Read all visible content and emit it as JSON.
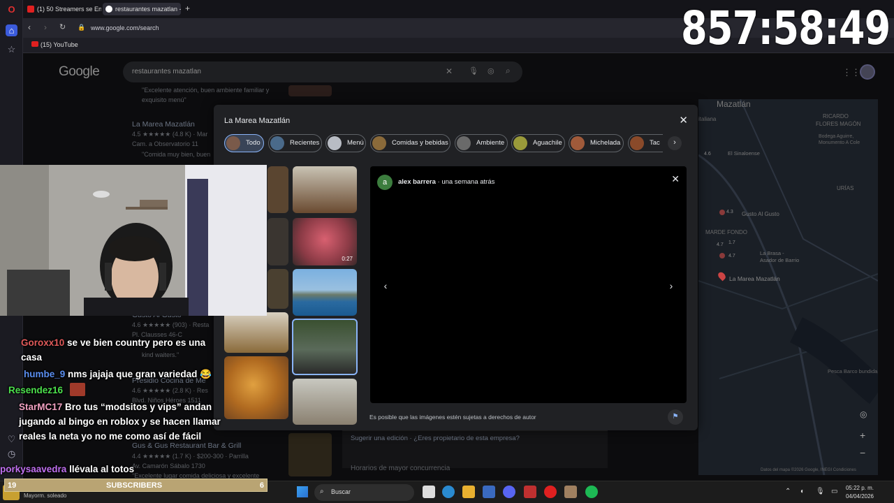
{
  "tabs": [
    {
      "label": "(1) 50 Streamers se Enfren"
    },
    {
      "label": "restaurantes mazatlan - B"
    }
  ],
  "address": {
    "url": "www.google.com/search"
  },
  "bookmarks": [
    {
      "label": "(15) YouTube"
    }
  ],
  "google": {
    "logo": "Google",
    "query": "restaurantes mazatlan"
  },
  "background_results": [
    {
      "text": "\"Excelente atención, buen ambiente familiar y"
    },
    {
      "text": "exquisito menú\""
    },
    {
      "text": "La Marea Mazatlán"
    },
    {
      "text": "4.5 ★★★★★ (4.8 K) · Mar"
    },
    {
      "text": "Cam. a Observatorio 11"
    },
    {
      "text": "\"Comida muy bien, buen"
    },
    {
      "text": "Gusto Al Gusto"
    },
    {
      "text": "4.6 ★★★★★ (903) · Resta"
    },
    {
      "text": "Pl. Clausses 46-C"
    },
    {
      "text": "kind waiters.\""
    },
    {
      "text": "Presidio Cocina de Me"
    },
    {
      "text": "4.6 ★★★★★ (2.8 K) · Res"
    },
    {
      "text": "Blvd. Niños Héroes 1511"
    },
    {
      "text": "Gus & Gus Restaurant Bar & Grill"
    },
    {
      "text": "4.4 ★★★★★ (1.7 K) · $200-300 · Parrilla"
    },
    {
      "text": "Av. Camarón Sábalo 1730"
    },
    {
      "text": "\"Excelente lugar comida deliciosa y excelente"
    }
  ],
  "panel_links": {
    "suggest": "Sugerir una edición · ¿Eres propietario de esta empresa?",
    "busy": "Horarios de mayor concurrencia"
  },
  "map": {
    "title": "Mazatlán",
    "labels": [
      "RICARDO",
      "FLORES MAGÓN",
      "URÍAS",
      "MARDE FONDO",
      "Gusto Al Gusto",
      "La Marea Mazatlán",
      "La Brasa -",
      "Asador de Barrio",
      "El Sinaloense",
      "Pesca Barco bundida",
      "Bodega Aguirre,",
      "Monumento A Cole",
      "italiana"
    ],
    "ratings": [
      "4.6",
      "4.3",
      "4.7",
      "1.7",
      "4.7"
    ],
    "attribution": "Datos del mapa ©2026 Google, INEGI   Condiciones"
  },
  "modal": {
    "title": "La Marea Mazatlán",
    "chips": [
      {
        "label": "Todo",
        "active": true
      },
      {
        "label": "Recientes"
      },
      {
        "label": "Menú"
      },
      {
        "label": "Comidas y bebidas"
      },
      {
        "label": "Ambiente"
      },
      {
        "label": "Aguachile"
      },
      {
        "label": "Michelada"
      },
      {
        "label": "Tac"
      }
    ],
    "video_badge": "0:27",
    "viewer": {
      "avatar_letter": "a",
      "reviewer": "alex barrera",
      "time": "· una semana atrás"
    },
    "copyright": "Es posible que las imágenes estén sujetas a derechos de autor"
  },
  "timer": "857:58:49",
  "chat": [
    {
      "user": "Goroxx10",
      "color": "#e05a5a",
      "message": "se ve bien country pero es una casa"
    },
    {
      "user": "humbe_9",
      "color": "#5a8ef0",
      "message": "nms jajaja que gran variedad 😂"
    },
    {
      "user": "Resendez16",
      "color": "#4ce04c",
      "message": ""
    },
    {
      "user": "StarMC17",
      "color": "#f0a0c0",
      "message": "Bro tus “modsitos y vips” andan jugando al bingo en roblox y se hacen llamar reales la neta yo no me como así de fácil"
    },
    {
      "user": "porkysaavedra",
      "color": "#c070f0",
      "message": "llévala al totos"
    }
  ],
  "subs": {
    "left": "19",
    "label": "SUBSCRIBERS",
    "right": "6"
  },
  "taskbar": {
    "weather": "Mayorm. soleado",
    "search": "Buscar",
    "time": "05:22 p. m.",
    "date": "04/04/2026"
  }
}
